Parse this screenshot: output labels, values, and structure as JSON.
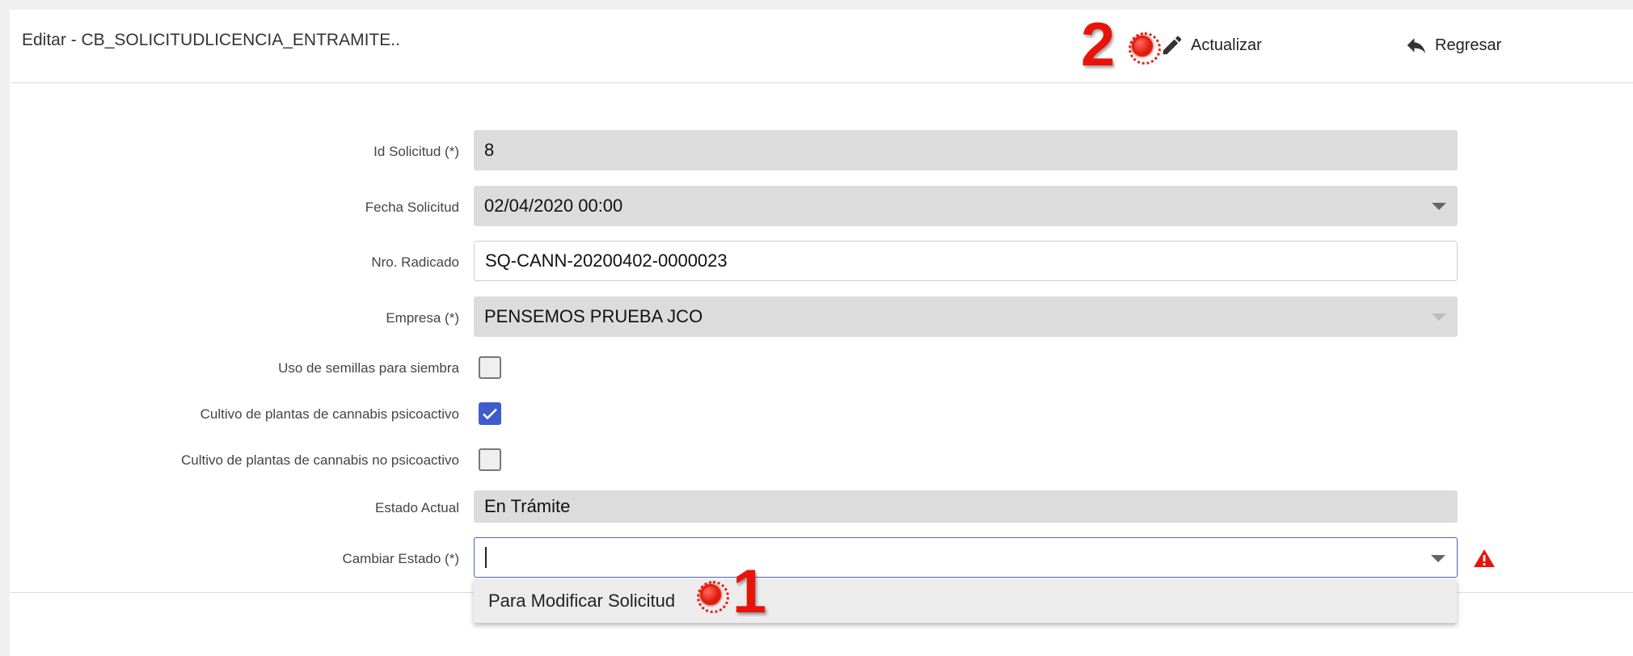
{
  "header": {
    "title": "Editar - CB_SOLICITUDLICENCIA_ENTRAMITE..",
    "update_label": "Actualizar",
    "back_label": "Regresar"
  },
  "annotations": {
    "step1": "1",
    "step2": "2",
    "marker_color": "#e01f10"
  },
  "form": {
    "id_solicitud": {
      "label": "Id Solicitud (*)",
      "value": "8"
    },
    "fecha_solicitud": {
      "label": "Fecha Solicitud",
      "value": "02/04/2020 00:00"
    },
    "nro_radicado": {
      "label": "Nro. Radicado",
      "value": "SQ-CANN-20200402-0000023"
    },
    "empresa": {
      "label": "Empresa (*)",
      "value": "PENSEMOS PRUEBA JCO"
    },
    "uso_semillas": {
      "label": "Uso de semillas para siembra",
      "checked": false
    },
    "cultivo_psicoactivo": {
      "label": "Cultivo de plantas de cannabis psicoactivo",
      "checked": true
    },
    "cultivo_no_psicoactivo": {
      "label": "Cultivo de plantas de cannabis no psicoactivo",
      "checked": false
    },
    "estado_actual": {
      "label": "Estado Actual",
      "value": "En Trámite"
    },
    "cambiar_estado": {
      "label": "Cambiar Estado (*)",
      "value": "",
      "options": [
        "Para Modificar Solicitud"
      ]
    }
  },
  "colors": {
    "accent": "#3f5ccc",
    "warning": "#e8140c"
  }
}
